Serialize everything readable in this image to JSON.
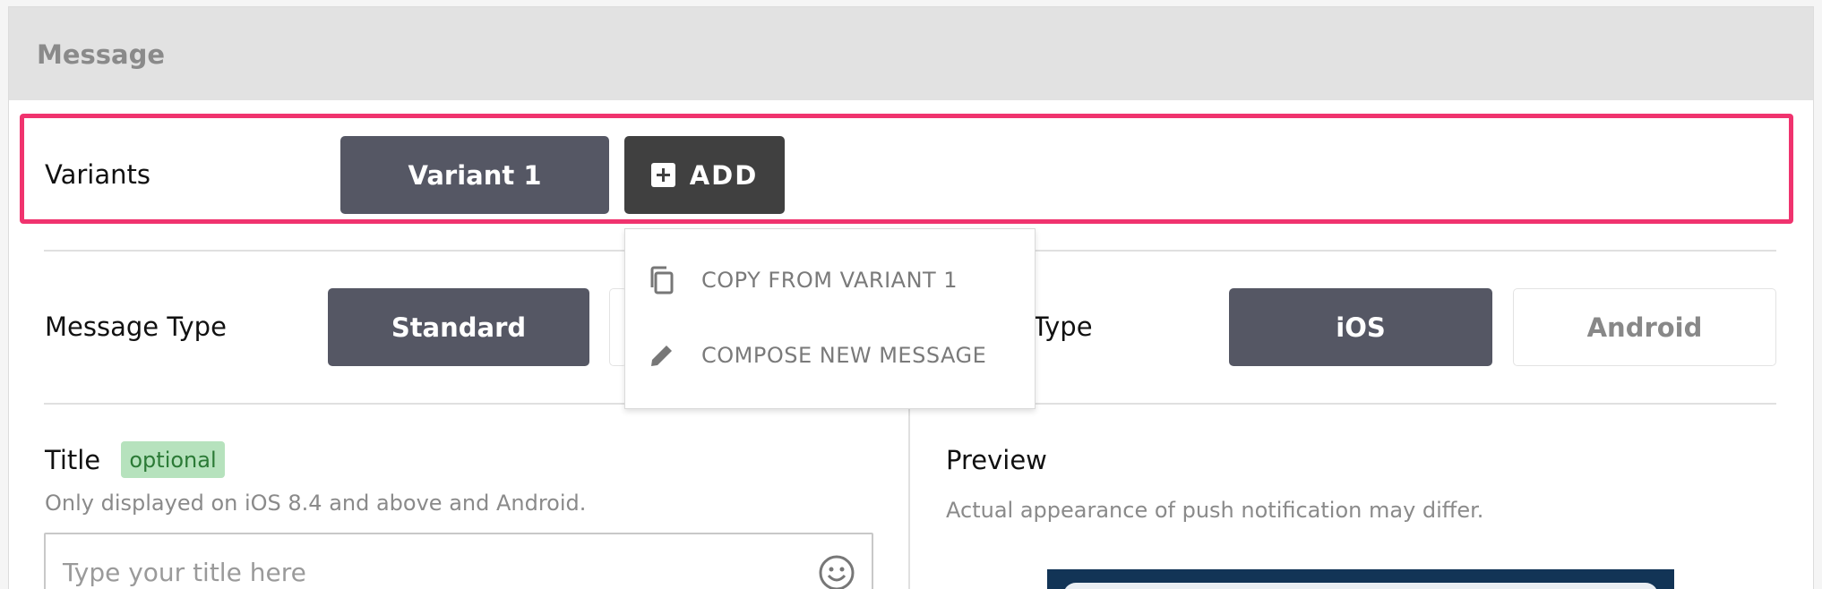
{
  "section": {
    "title": "Message"
  },
  "variants": {
    "label": "Variants",
    "tabs": [
      "Variant 1"
    ],
    "add_label": "ADD"
  },
  "dropdown": {
    "items": [
      {
        "label": "COPY FROM VARIANT 1",
        "icon": "copy-icon"
      },
      {
        "label": "COMPOSE NEW MESSAGE",
        "icon": "pencil-icon"
      }
    ]
  },
  "message_type": {
    "label": "Message Type",
    "options": [
      "Standard"
    ],
    "selected": "Standard"
  },
  "preview_type": {
    "label_visible": "w Type",
    "options": [
      "iOS",
      "Android"
    ],
    "selected": "iOS"
  },
  "title_field": {
    "label": "Title",
    "badge": "optional",
    "helper": "Only displayed on iOS 8.4 and above and Android.",
    "placeholder": "Type your title here",
    "value": ""
  },
  "preview": {
    "label": "Preview",
    "helper": "Actual appearance of push notification may differ."
  },
  "colors": {
    "highlight": "#f0336e",
    "selected_button": "#555764",
    "add_button": "#404040",
    "badge_bg": "#b6e2bd",
    "badge_text": "#2b7a36",
    "preview_bg": "#123456"
  }
}
